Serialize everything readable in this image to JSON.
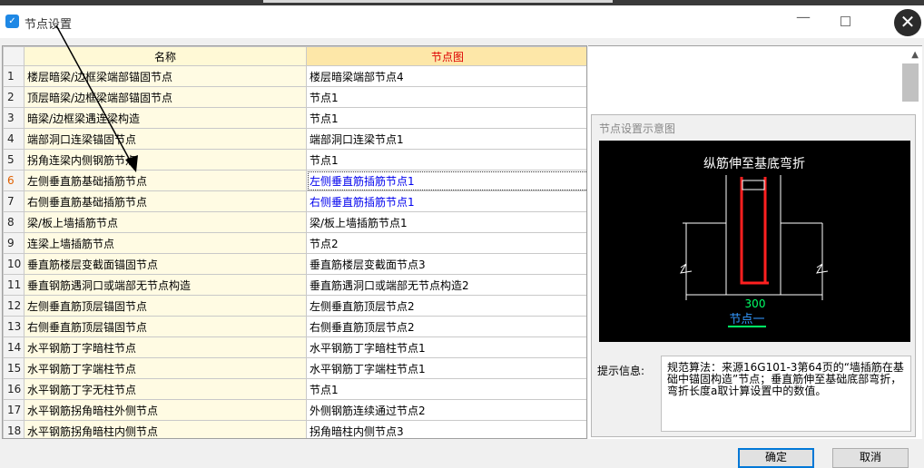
{
  "window": {
    "title": "节点设置"
  },
  "table": {
    "headers": {
      "name": "名称",
      "node": "节点图"
    },
    "rows": [
      {
        "idx": "1",
        "name": "楼层暗梁/边框梁端部锚固节点",
        "node": "楼层暗梁端部节点4"
      },
      {
        "idx": "2",
        "name": "顶层暗梁/边框梁端部锚固节点",
        "node": "节点1"
      },
      {
        "idx": "3",
        "name": "暗梁/边框梁遇连梁构造",
        "node": "节点1"
      },
      {
        "idx": "4",
        "name": "端部洞口连梁锚固节点",
        "node": "端部洞口连梁节点1"
      },
      {
        "idx": "5",
        "name": "拐角连梁内侧钢筋节点",
        "node": "节点1"
      },
      {
        "idx": "6",
        "name": "左侧垂直筋基础插筋节点",
        "node": "左侧垂直筋插筋节点1"
      },
      {
        "idx": "7",
        "name": "右侧垂直筋基础插筋节点",
        "node": "右侧垂直筋插筋节点1"
      },
      {
        "idx": "8",
        "name": "梁/板上墙插筋节点",
        "node": "梁/板上墙插筋节点1"
      },
      {
        "idx": "9",
        "name": "连梁上墙插筋节点",
        "node": "节点2"
      },
      {
        "idx": "10",
        "name": "垂直筋楼层变截面锚固节点",
        "node": "垂直筋楼层变截面节点3"
      },
      {
        "idx": "11",
        "name": "垂直钢筋遇洞口或端部无节点构造",
        "node": "垂直筋遇洞口或端部无节点构造2"
      },
      {
        "idx": "12",
        "name": "左侧垂直筋顶层锚固节点",
        "node": "左侧垂直筋顶层节点2"
      },
      {
        "idx": "13",
        "name": "右侧垂直筋顶层锚固节点",
        "node": "右侧垂直筋顶层节点2"
      },
      {
        "idx": "14",
        "name": "水平钢筋丁字暗柱节点",
        "node": "水平钢筋丁字暗柱节点1"
      },
      {
        "idx": "15",
        "name": "水平钢筋丁字端柱节点",
        "node": "水平钢筋丁字端柱节点1"
      },
      {
        "idx": "16",
        "name": "水平钢筋丁字无柱节点",
        "node": "节点1"
      },
      {
        "idx": "17",
        "name": "水平钢筋拐角暗柱外侧节点",
        "node": "外侧钢筋连续通过节点2"
      },
      {
        "idx": "18",
        "name": "水平钢筋拐角暗柱内侧节点",
        "node": "拐角暗柱内侧节点3"
      }
    ]
  },
  "diagram": {
    "panel_title": "节点设置示意图",
    "caption": "纵筋伸至基底弯折",
    "dimension": "300",
    "node_label": "节点一"
  },
  "hint": {
    "label": "提示信息:",
    "text": "规范算法：来源16G101-3第64页的“墙插筋在基础中锚固构造”节点；垂直筋伸至基础底部弯折，弯折长度a取计算设置中的数值。"
  },
  "buttons": {
    "ok": "确定",
    "cancel": "取消"
  },
  "colors": {
    "selected_index": "#e06000",
    "link_text": "#0000ee",
    "header_node": "#dd0000",
    "rebar": "#ff2020",
    "dimension": "#00ff66"
  }
}
